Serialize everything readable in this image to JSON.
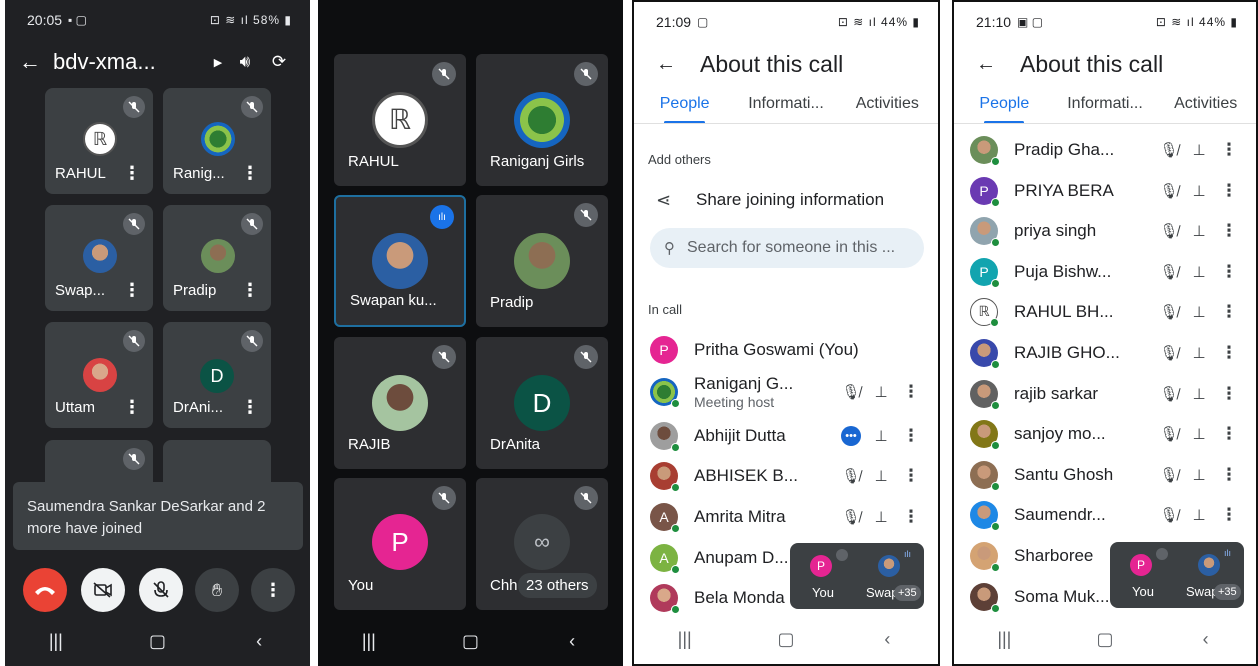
{
  "panel1": {
    "status": {
      "time": "20:05",
      "battery": "58%",
      "icons": "▪ ▢   ⚿ ≋ ᵛᵒ.ıl"
    },
    "title": "bdv-xma...",
    "tiles": [
      {
        "name": "RAHUL"
      },
      {
        "name": "Ranig..."
      },
      {
        "name": "Swap..."
      },
      {
        "name": "Pradip"
      },
      {
        "name": "Uttam"
      },
      {
        "name": "DrAni...",
        "initial": "D"
      }
    ],
    "toast": "Saumendra Sankar DeSarkar and 2 more have joined"
  },
  "panel2": {
    "tiles": [
      {
        "name": "RAHUL"
      },
      {
        "name": "Raniganj Girls"
      },
      {
        "name": "Swapan    ku..."
      },
      {
        "name": "Pradip"
      },
      {
        "name": "RAJIB"
      },
      {
        "name": "DrAnita",
        "initial": "D"
      },
      {
        "name": "You",
        "initial": "P"
      },
      {
        "name": "Chh"
      }
    ],
    "others": "23 others"
  },
  "panel3": {
    "status": {
      "time": "21:09",
      "battery": "44%"
    },
    "title": "About this call",
    "tabs": [
      "People",
      "Informati...",
      "Activities"
    ],
    "add_others": "Add others",
    "share": "Share joining information",
    "search_placeholder": "Search for someone in this ...",
    "in_call": "In call",
    "people": [
      {
        "name": "Pritha Goswami (You)",
        "initial": "P",
        "color": "#e52592"
      },
      {
        "name": "Raniganj G...",
        "sub": "Meeting host"
      },
      {
        "name": "Abhijit Dutta"
      },
      {
        "name": "ABHISEK B..."
      },
      {
        "name": "Amrita Mitra",
        "initial": "A",
        "color": "#795548"
      },
      {
        "name": "Anupam D...",
        "initial": "A",
        "color": "#7cb342"
      },
      {
        "name": "Bela Monda"
      }
    ],
    "pip": {
      "you": "You",
      "you_initial": "P",
      "other": "Swap",
      "count": "+35"
    }
  },
  "panel4": {
    "status": {
      "time": "21:10",
      "battery": "44%"
    },
    "title": "About this call",
    "tabs": [
      "People",
      "Informati...",
      "Activities"
    ],
    "people": [
      {
        "name": "Pradip Gha..."
      },
      {
        "name": "PRIYA BERA",
        "initial": "P",
        "color": "#6a3ab2"
      },
      {
        "name": "priya singh"
      },
      {
        "name": "Puja Bishw...",
        "initial": "P",
        "color": "#12a4af"
      },
      {
        "name": "RAHUL BH..."
      },
      {
        "name": "RAJIB GHO..."
      },
      {
        "name": "rajib sarkar"
      },
      {
        "name": "sanjoy mo..."
      },
      {
        "name": "Santu Ghosh"
      },
      {
        "name": "Saumendr..."
      },
      {
        "name": "Sharboree"
      },
      {
        "name": "Soma Muk..."
      }
    ],
    "pip": {
      "you": "You",
      "you_initial": "P",
      "other": "Swap",
      "count": "+35"
    }
  }
}
